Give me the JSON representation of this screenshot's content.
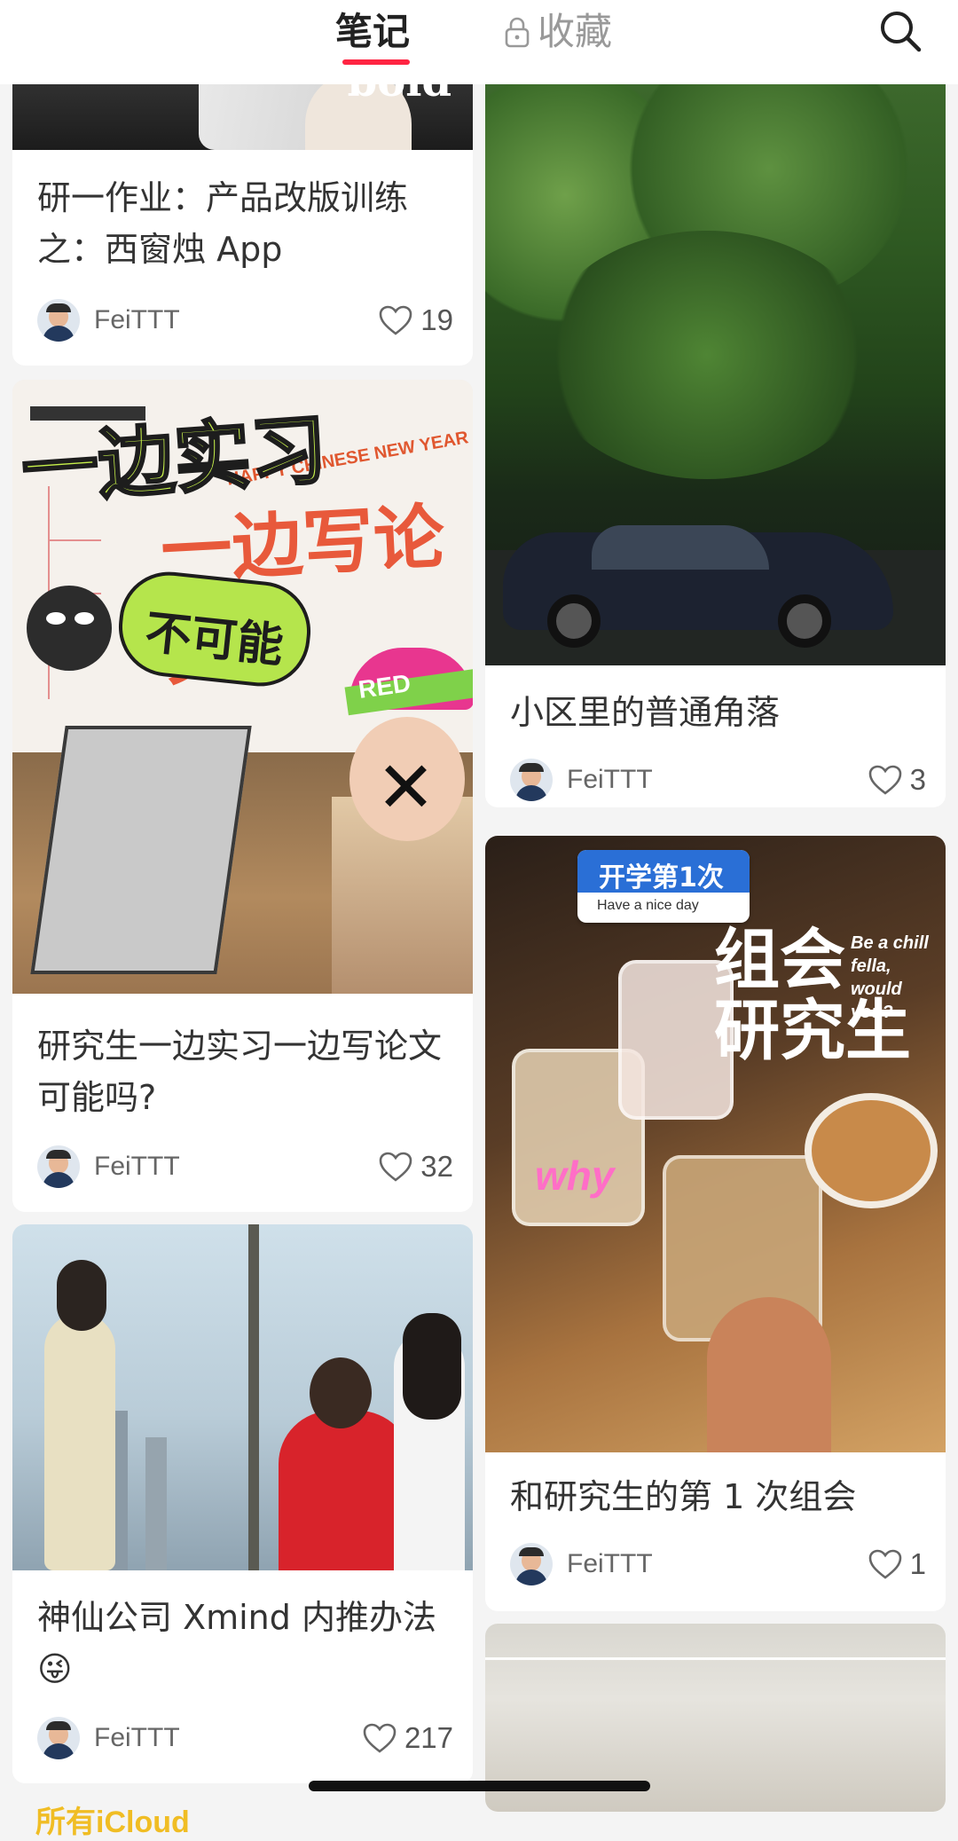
{
  "tabs": {
    "notes": "笔记",
    "favorites": "收藏"
  },
  "accent_color": "#ff2442",
  "icons": {
    "lock": "lock-icon",
    "search": "search-icon",
    "like": "heart-outline-icon"
  },
  "cards": [
    {
      "title": "研一作业：产品改版训练之：西窗烛 App",
      "author": "FeiTTT",
      "likes": "19",
      "image_text": "bold"
    },
    {
      "title": "研究生一边实习一边写论文可能吗?",
      "author": "FeiTTT",
      "likes": "32",
      "image_text": {
        "line1": "一边实习",
        "line2": "一边写论文",
        "badge": "不可能",
        "banner": "HAPPY CHINESE NEW YEAR",
        "headband": "RED"
      }
    },
    {
      "title": "神仙公司 Xmind 内推办法 😜",
      "author": "FeiTTT",
      "likes": "217"
    },
    {
      "title": "小区里的普通角落",
      "author": "FeiTTT",
      "likes": "3"
    },
    {
      "title": "和研究生的第 1 次组会",
      "author": "FeiTTT",
      "likes": "1",
      "image_text": {
        "tag": "开学第1次",
        "tag_sub": "Have a nice day",
        "big1": "组会",
        "big2": "研究生",
        "side": "Be a chill fella, would you?",
        "cup": "why"
      }
    }
  ],
  "bottom_peek": "所有iCloud"
}
